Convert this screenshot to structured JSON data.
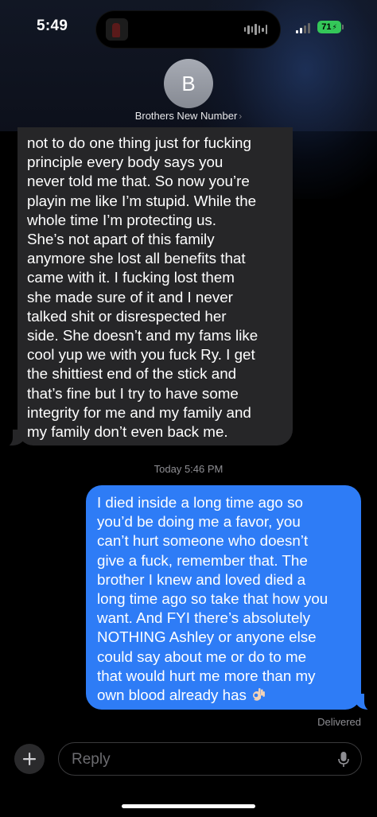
{
  "status_bar": {
    "time": "5:49",
    "battery": "71"
  },
  "header": {
    "avatar_initial": "B",
    "contact_name": "Brothers New Number"
  },
  "messages": {
    "incoming_text": "not to do one thing just for fucking\nprinciple every body says you\nnever told me that. So now you’re\nplayin me like I’m stupid. While the\nwhole time I’m protecting us.\nShe’s not apart of this family\nanymore she lost all benefits that\ncame with it. I fucking lost them\nshe made sure of it and I never\ntalked shit or disrespected her\nside. She doesn’t and my fams like\ncool yup we with you fuck Ry. I get\nthe shittiest end of the stick and\nthat’s fine but I try to have some\nintegrity for me and my family and\nmy family don’t even back me.",
    "timestamp_day": "Today",
    "timestamp_time": "5:46 PM",
    "outgoing_text": "I died inside a long time ago so\nyou’d be doing me a favor, you\ncan’t hurt someone who doesn’t\ngive a fuck, remember that. The\nbrother I knew and loved died a\nlong time ago so take that how you\nwant. And FYI there’s absolutely\nNOTHING Ashley or anyone else\ncould say about me or do to me\nthat would hurt me more than my\nown blood already has",
    "outgoing_emoji": "ok-hand-emoji",
    "status": "Delivered"
  },
  "composer": {
    "placeholder": "Reply"
  },
  "colors": {
    "incoming_bubble": "#262628",
    "outgoing_bubble": "#2e7cf6",
    "battery": "#34c759"
  }
}
